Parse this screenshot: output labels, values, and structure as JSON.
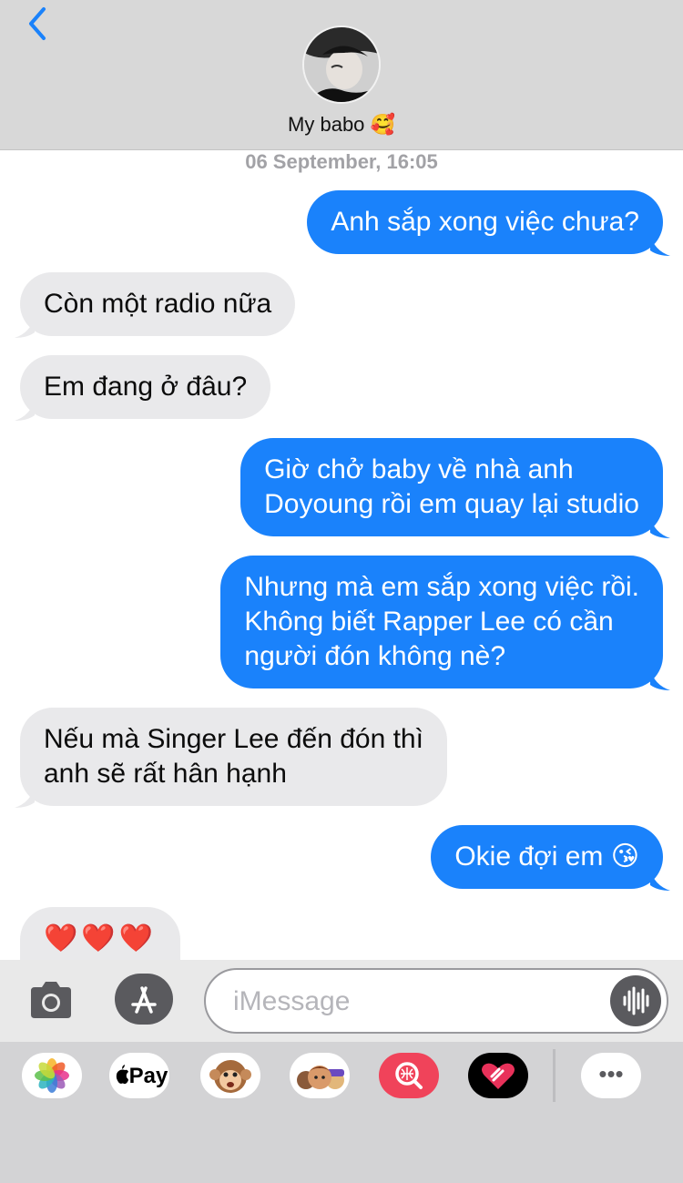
{
  "header": {
    "contact_name": "My babo",
    "contact_emoji": "🥰"
  },
  "timestamp": "06 September, 16:05",
  "messages": [
    {
      "from": "me",
      "lines": [
        "Anh sắp xong việc chưa?"
      ]
    },
    {
      "from": "them",
      "lines": [
        "Còn một radio nữa"
      ]
    },
    {
      "from": "them",
      "lines": [
        "Em đang ở đâu?"
      ]
    },
    {
      "from": "me",
      "lines": [
        "Giờ chở baby về nhà anh",
        "Doyoung rồi em quay lại studio"
      ]
    },
    {
      "from": "me",
      "lines": [
        "Nhưng mà em sắp xong việc rồi.",
        "Không biết Rapper Lee có cần",
        "người đón không nè?"
      ]
    },
    {
      "from": "them",
      "lines": [
        "Nếu mà Singer Lee đến đón thì",
        "anh sẽ rất hân hạnh"
      ]
    },
    {
      "from": "me",
      "lines": [
        "Okie đợi em"
      ],
      "emoji": "😘"
    },
    {
      "from": "them",
      "lines": [
        "❤️❤️❤️"
      ]
    }
  ],
  "input": {
    "placeholder": "iMessage"
  },
  "apps": {
    "apple_pay_label": "Pay",
    "more_label": "•••"
  },
  "icons": [
    "back-chevron-icon",
    "camera-icon",
    "app-store-icon",
    "audio-waveform-icon",
    "photos-icon",
    "apple-pay-icon",
    "animoji-icon",
    "memoji-icon",
    "search-images-icon",
    "digital-touch-icon",
    "more-icon"
  ],
  "colors": {
    "me_bubble": "#1a82fb",
    "them_bubble": "#e9e9eb",
    "accent": "#1a82fb"
  }
}
